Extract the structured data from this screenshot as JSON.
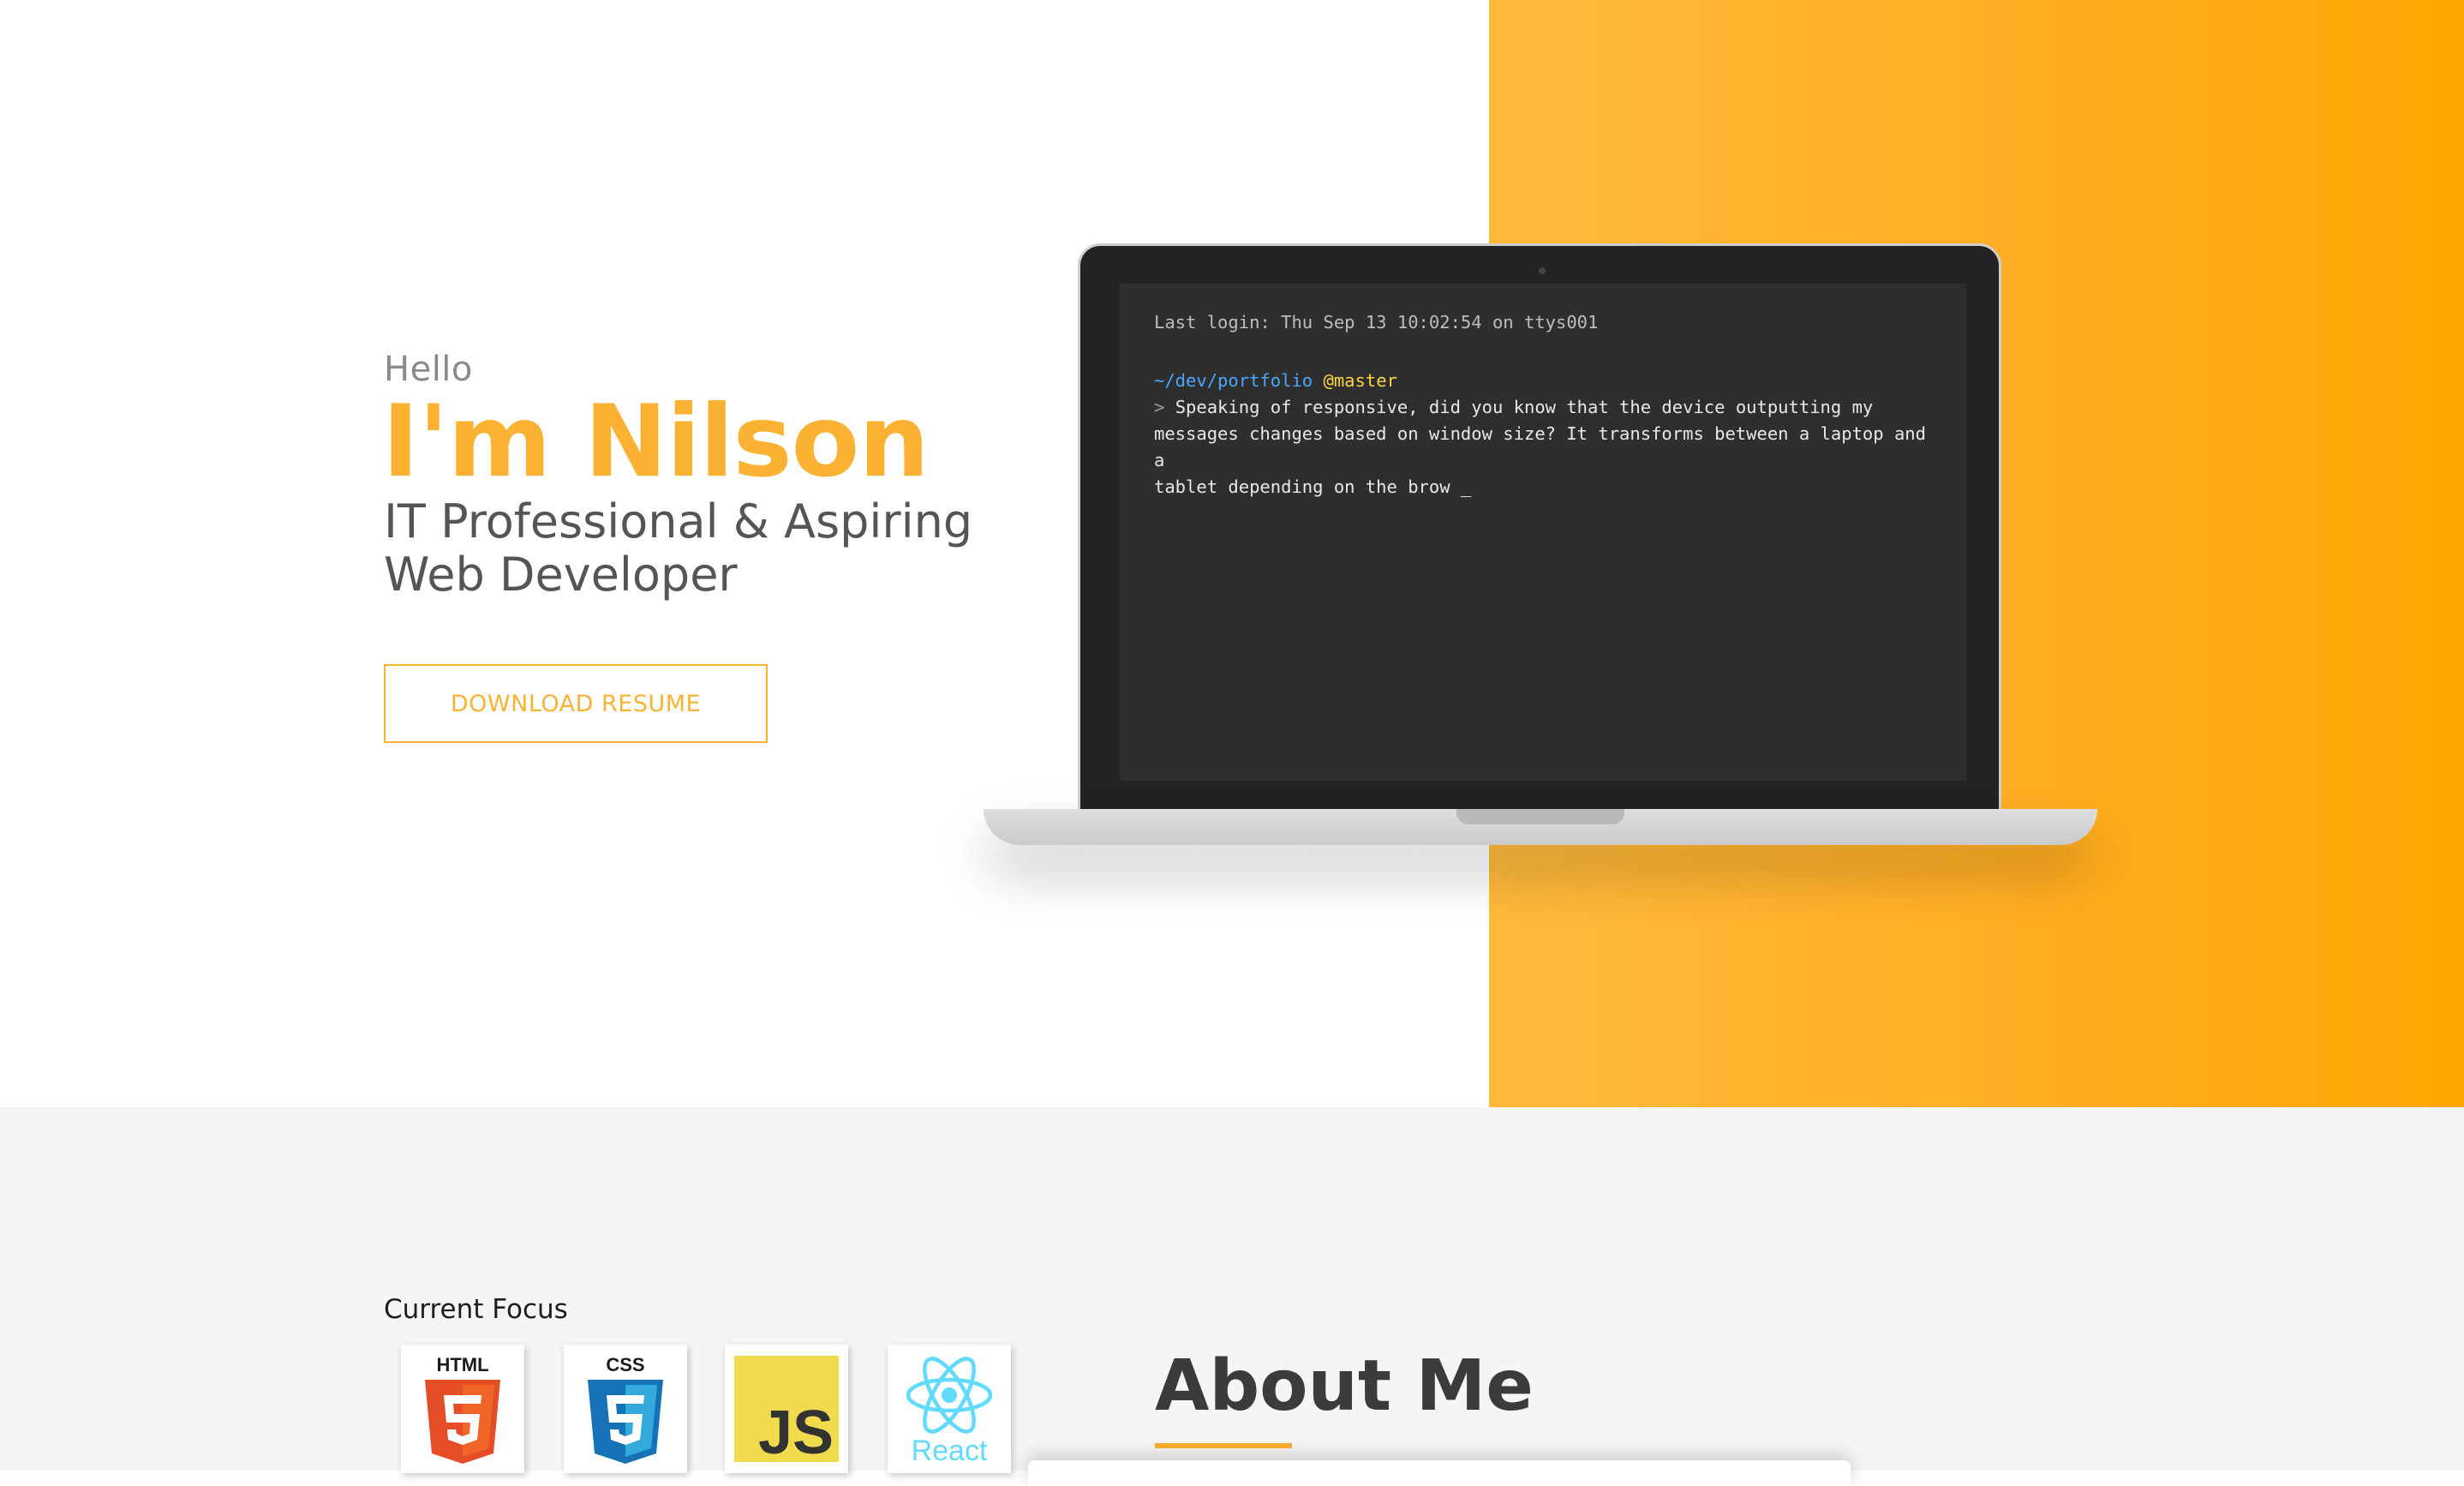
{
  "hero": {
    "greeting": "Hello",
    "name": "I'm Nilson",
    "tagline_line1": "IT Professional & Aspiring",
    "tagline_line2": "Web Developer",
    "download_button": "DOWNLOAD RESUME"
  },
  "terminal": {
    "last_login": "Last login: Thu Sep 13 10:02:54 on ttys001",
    "path": "~/dev/portfolio",
    "branch": "@master",
    "prompt": ">",
    "message_line1": "Speaking of responsive, did you know that the device outputting my",
    "message_line2": "messages changes based on window size? It transforms between a laptop and a",
    "message_line3": "tablet depending on the brow",
    "cursor": "_"
  },
  "focus": {
    "title": "Current Focus",
    "items": [
      {
        "label": "HTML",
        "icon": "html5-icon",
        "color": "#e44d26"
      },
      {
        "label": "CSS",
        "icon": "css3-icon",
        "color": "#1572b6"
      },
      {
        "label": "JS",
        "icon": "javascript-icon",
        "color": "#f0db4f"
      },
      {
        "label": "React",
        "icon": "react-icon",
        "color": "#61dafb"
      }
    ]
  },
  "about": {
    "title": "About Me"
  },
  "colors": {
    "accent": "#fbb233",
    "accent_gradient_end": "#ffa600",
    "terminal_bg": "#2e2e2e",
    "terminal_path": "#49a6ff",
    "terminal_branch": "#ffd53d"
  }
}
